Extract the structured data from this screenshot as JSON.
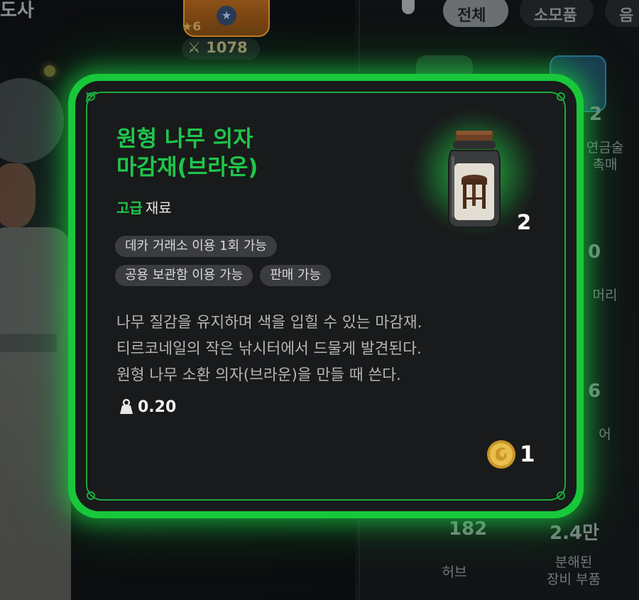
{
  "background": {
    "top_left_text": "도사",
    "character_rank": "★6",
    "combat_power": "1078",
    "filter_tabs": [
      {
        "label": "전체",
        "active": true
      },
      {
        "label": "소모품",
        "active": false
      },
      {
        "label": "음",
        "active": false
      }
    ],
    "grid": [
      {
        "value": "2",
        "label": "연금술\n촉매"
      },
      {
        "value": "0",
        "label": "머리"
      },
      {
        "value": "6",
        "label": "어"
      },
      {
        "value": "182",
        "label": "허브"
      },
      {
        "value": "2.4만",
        "label": "분해된\n장비 부품"
      }
    ]
  },
  "tooltip": {
    "item_name": "원형 나무 의자\n마감재(브라운)",
    "grade": "고급",
    "item_type": "재료",
    "icon": "stool-dye-jar-icon",
    "quantity": "2",
    "tags": [
      [
        "데카 거래소 이용 1회 가능"
      ],
      [
        "공용 보관함 이용 가능",
        "판매 가능"
      ]
    ],
    "description": [
      "나무 질감을 유지하며 색을 입힐 수 있는 마감재.",
      "티르코네일의 작은 낚시터에서 드물게 발견된다.",
      "원형 나무 소환 의자(브라운)을 만들 때 쓴다."
    ],
    "weight": "0.20",
    "weight_icon": "weight-icon",
    "price": "1",
    "price_icon": "gold-coin-icon",
    "colors": {
      "grade_green": "#1fc64b",
      "border_glow": "#18c83a",
      "card_bg": "#191a1b",
      "tag_bg": "#3a3c3f"
    }
  }
}
